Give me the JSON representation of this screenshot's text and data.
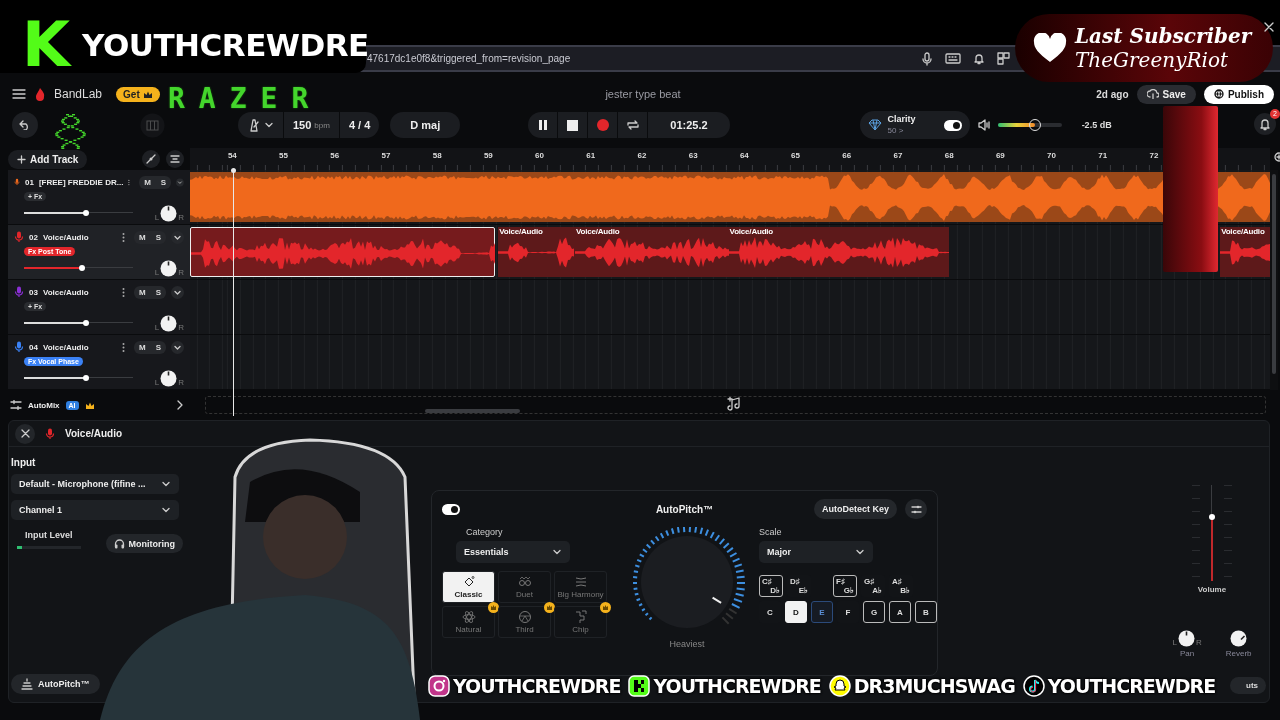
{
  "overlay": {
    "logo_letter": "K",
    "channel": "YOUTHCREWDRE",
    "sponsor": "RAZER",
    "last_subscriber": {
      "label": "Last Subscriber",
      "name": "TheGreenyRiot"
    },
    "socials": [
      {
        "kind": "instagram",
        "handle": "YOUTHCREWDRE"
      },
      {
        "kind": "kick",
        "handle": "YOUTHCREWDRE"
      },
      {
        "kind": "snapchat",
        "handle": "DR3MUCHSWAG"
      },
      {
        "kind": "tiktok",
        "handle": "YOUTHCREWDRE"
      }
    ]
  },
  "browser": {
    "url": "47617dc1e0f8&triggered_from=revision_page"
  },
  "header": {
    "app_name": "BandLab",
    "get_badge": "Get",
    "project_title": "jester type beat",
    "saved": "2d ago",
    "save": "Save",
    "publish": "Publish"
  },
  "toolbar": {
    "tempo": "150",
    "tempo_unit": "bpm",
    "time_signature": "4 / 4",
    "key": "D maj",
    "playing": true,
    "time": "01:25.2",
    "clarity": {
      "label": "Clarity",
      "value": "50 >",
      "on": true
    },
    "master": {
      "level": 0.58,
      "reading": "-2.5 dB"
    },
    "notifications": "2"
  },
  "timeline": {
    "add_track": "Add Track",
    "bars": [
      "54",
      "55",
      "56",
      "57",
      "58",
      "59",
      "60",
      "61",
      "62",
      "63",
      "64",
      "65",
      "66",
      "67",
      "68",
      "69",
      "70",
      "71",
      "72"
    ]
  },
  "tracks": [
    {
      "number": "01",
      "name": "[FREE] FREDDIE DR...",
      "color": "#f0691c",
      "selected": false,
      "fx": {
        "label": "+ Fx"
      },
      "mute": "M",
      "solo": "S",
      "level": 0.57,
      "pan": {
        "left": "L",
        "right": "R"
      },
      "clips": [
        {
          "selected": false
        }
      ]
    },
    {
      "number": "02",
      "name": "Voice/Audio",
      "color": "#e3262b",
      "selected": true,
      "fx": {
        "label": "Fx Post Tone",
        "color": "#e3262b"
      },
      "mute": "M",
      "solo": "S",
      "level": 0.53,
      "pan": {
        "left": "L",
        "right": "R"
      },
      "clips": [
        {
          "selected": true
        },
        {
          "label": "Voice/Audio",
          "selected": false
        },
        {
          "label": "Voice/Audio",
          "selected": false
        },
        {
          "label": "Voice/Audio",
          "selected": false
        },
        {
          "label": "Voice/Audio",
          "selected": false
        }
      ]
    },
    {
      "number": "03",
      "name": "Voice/Audio",
      "color": "#8b2fd6",
      "selected": false,
      "fx": {
        "label": "+ Fx"
      },
      "mute": "M",
      "solo": "S",
      "level": 0.57,
      "pan": {
        "left": "L",
        "right": "R"
      }
    },
    {
      "number": "04",
      "name": "Voice/Audio",
      "color": "#3b82f6",
      "selected": false,
      "fx": {
        "label": "Fx Vocal Phase",
        "color": "#3b82f6"
      },
      "mute": "M",
      "solo": "S",
      "level": 0.57,
      "pan": {
        "left": "L",
        "right": "R"
      }
    }
  ],
  "automix": {
    "label": "AutoMix",
    "badge": "AI"
  },
  "editor": {
    "title": "Voice/Audio",
    "input_label": "Input",
    "device": "Default - Microphone (fifine ...",
    "channel": "Channel 1",
    "input_level": {
      "label": "Input Level",
      "level": 0.08
    },
    "monitoring": "Monitoring",
    "autopitch_tab": "AutoPitch™",
    "autopitch": {
      "on": true,
      "title": "AutoPitch™",
      "detect_key": "AutoDetect Key",
      "category_label": "Category",
      "category": "Essentials",
      "presets": [
        {
          "label": "Classic",
          "selected": true,
          "premium": false
        },
        {
          "label": "Duet",
          "selected": false,
          "premium": false
        },
        {
          "label": "Big Harmony",
          "selected": false,
          "premium": false
        },
        {
          "label": "Natural",
          "selected": false,
          "premium": true
        },
        {
          "label": "Third",
          "selected": false,
          "premium": true
        },
        {
          "label": "Chip",
          "selected": false,
          "premium": true
        }
      ],
      "strength": {
        "label": "Heaviest",
        "level": 0.95
      },
      "scale_label": "Scale",
      "scale": "Major",
      "sharps": [
        {
          "top": "C♯",
          "bottom": "D♭",
          "in_scale": true,
          "selected": false,
          "highlighted": false
        },
        {
          "top": "D♯",
          "bottom": "E♭",
          "in_scale": false,
          "selected": false,
          "highlighted": false
        },
        {
          "top": "F♯",
          "bottom": "G♭",
          "in_scale": true,
          "selected": false,
          "highlighted": false
        },
        {
          "top": "G♯",
          "bottom": "A♭",
          "in_scale": false,
          "selected": false,
          "highlighted": false
        },
        {
          "top": "A♯",
          "bottom": "B♭",
          "in_scale": false,
          "selected": false,
          "highlighted": false
        }
      ],
      "naturals": [
        {
          "label": "C",
          "in_scale": false,
          "selected": false,
          "highlighted": false
        },
        {
          "label": "D",
          "in_scale": true,
          "selected": true,
          "highlighted": false
        },
        {
          "label": "E",
          "in_scale": true,
          "selected": false,
          "highlighted": true
        },
        {
          "label": "F",
          "in_scale": false,
          "selected": false,
          "highlighted": false
        },
        {
          "label": "G",
          "in_scale": true,
          "selected": false,
          "highlighted": false
        },
        {
          "label": "A",
          "in_scale": true,
          "selected": false,
          "highlighted": false
        },
        {
          "label": "B",
          "in_scale": true,
          "selected": false,
          "highlighted": false
        }
      ]
    },
    "volume": {
      "label": "Volume",
      "level": 0.67
    },
    "pan": {
      "label": "Pan",
      "left": "L",
      "right": "R"
    },
    "reverb": {
      "label": "Reverb"
    },
    "shortcuts_fragment": "uts"
  }
}
